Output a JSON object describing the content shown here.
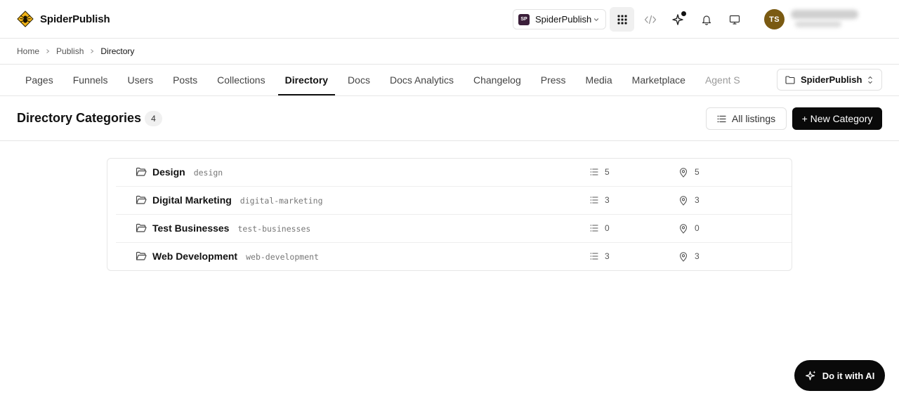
{
  "header": {
    "brand_name": "SpiderPublish",
    "workspace": {
      "badge": "SP",
      "name": "SpiderPublish"
    },
    "user": {
      "initials": "TS"
    },
    "icons": [
      "apps-grid-icon",
      "code-icon",
      "ai-sparkle-icon",
      "bell-icon",
      "monitor-icon"
    ]
  },
  "breadcrumb": {
    "items": [
      "Home",
      "Publish",
      "Directory"
    ]
  },
  "tabs": [
    {
      "label": "Pages"
    },
    {
      "label": "Funnels"
    },
    {
      "label": "Users"
    },
    {
      "label": "Posts"
    },
    {
      "label": "Collections"
    },
    {
      "label": "Directory",
      "active": true
    },
    {
      "label": "Docs"
    },
    {
      "label": "Docs Analytics"
    },
    {
      "label": "Changelog"
    },
    {
      "label": "Press"
    },
    {
      "label": "Media"
    },
    {
      "label": "Marketplace"
    },
    {
      "label": "Agent S"
    }
  ],
  "site_selector": {
    "label": "SpiderPublish"
  },
  "page": {
    "title": "Directory Categories",
    "count": "4",
    "all_listings_label": "All listings",
    "new_category_label": "+ New Category"
  },
  "categories": [
    {
      "name": "Design",
      "slug": "design",
      "listings": "5",
      "locations": "5"
    },
    {
      "name": "Digital Marketing",
      "slug": "digital-marketing",
      "listings": "3",
      "locations": "3"
    },
    {
      "name": "Test Businesses",
      "slug": "test-businesses",
      "listings": "0",
      "locations": "0"
    },
    {
      "name": "Web Development",
      "slug": "web-development",
      "listings": "3",
      "locations": "3"
    }
  ],
  "ai_button": {
    "label": "Do it with AI"
  },
  "colors": {
    "primary": "#0a0a0a",
    "avatar": "#7a5a12",
    "workspace_badge": "#3b1f3a",
    "brand_logo": "#f2b418"
  }
}
